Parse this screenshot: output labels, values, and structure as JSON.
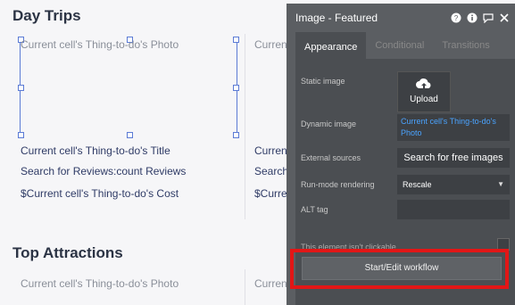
{
  "left": {
    "day_trips": {
      "title": "Day Trips",
      "photo_label": "Current cell's Thing-to-do's Photo",
      "title_label": "Current cell's Thing-to-do's Title",
      "reviews_label": "Search for Reviews:count Reviews",
      "cost_label": "$Current cell's Thing-to-do's Cost",
      "right_col": {
        "photo_label": "Current",
        "title_label": "Current",
        "reviews_label": "Search",
        "cost_label": "$Curren"
      }
    },
    "top_attractions": {
      "title": "Top Attractions",
      "photo_label": "Current cell's Thing-to-do's Photo",
      "right_col_label": "Current"
    }
  },
  "panel": {
    "title": "Image - Featured",
    "icons": [
      "help-icon",
      "info-icon",
      "comment-icon",
      "close-icon"
    ],
    "tabs": [
      {
        "label": "Appearance",
        "active": true
      },
      {
        "label": "Conditional",
        "active": false
      },
      {
        "label": "Transitions",
        "active": false
      }
    ],
    "static_image_label": "Static image",
    "upload_label": "Upload",
    "dynamic_image_label": "Dynamic image",
    "dynamic_image_value": "Current cell's Thing-to-do's Photo",
    "external_sources_label": "External sources",
    "search_free_images": "Search for free images",
    "run_mode_label": "Run-mode rendering",
    "run_mode_value": "Rescale",
    "alt_tag_label": "ALT tag",
    "not_clickable_label": "This element isn't clickable",
    "workflow_button": "Start/Edit workflow"
  },
  "colors": {
    "highlight": "#e21616",
    "panel_bg": "#5b5e62",
    "link_blue": "#4aa3ff",
    "text_navy": "#2f3b66"
  }
}
